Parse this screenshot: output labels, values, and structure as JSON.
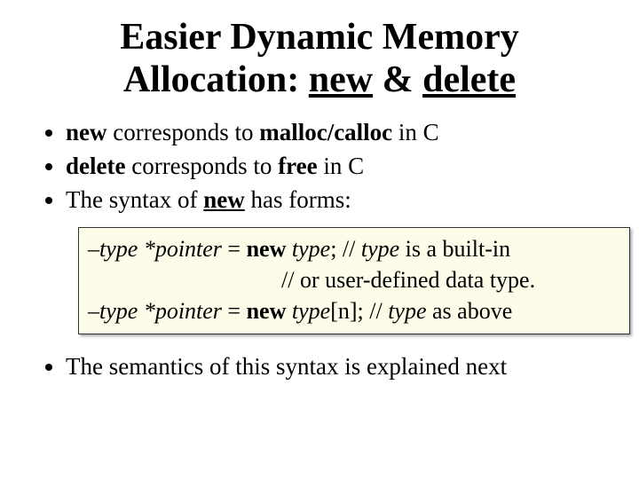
{
  "title": {
    "line1_prefix": "Easier Dynamic Memory",
    "line2_prefix": "Allocation: ",
    "kw_new": "new",
    "amp": " & ",
    "kw_delete": "delete"
  },
  "bullets": {
    "b1": {
      "kw": "new",
      "mid": " corresponds to ",
      "func": "malloc/calloc",
      "tail": " in C"
    },
    "b2": {
      "kw": "delete",
      "mid": " corresponds to ",
      "func": "free",
      "tail": " in C"
    },
    "b3": {
      "pre": "The syntax of ",
      "kw": "new",
      "post": " has forms:"
    }
  },
  "code": {
    "l1": {
      "dash": "–",
      "type1": "type",
      "ptr": " *pointer",
      "eq": " = ",
      "newkw": "new",
      "sp": " ",
      "type2": "type",
      "semi": "; // ",
      "type3": "type",
      "tail": " is a built-in"
    },
    "l2": {
      "text": "// or user-defined data type."
    },
    "l3": {
      "dash": "–",
      "type1": "type",
      "ptr": " *pointer",
      "eq": " = ",
      "newkw": "new",
      "sp": " ",
      "type2": "type",
      "arr": "[n]; // ",
      "type3": "type",
      "tail": " as above"
    }
  },
  "bullet4": "The semantics of this syntax is explained next"
}
